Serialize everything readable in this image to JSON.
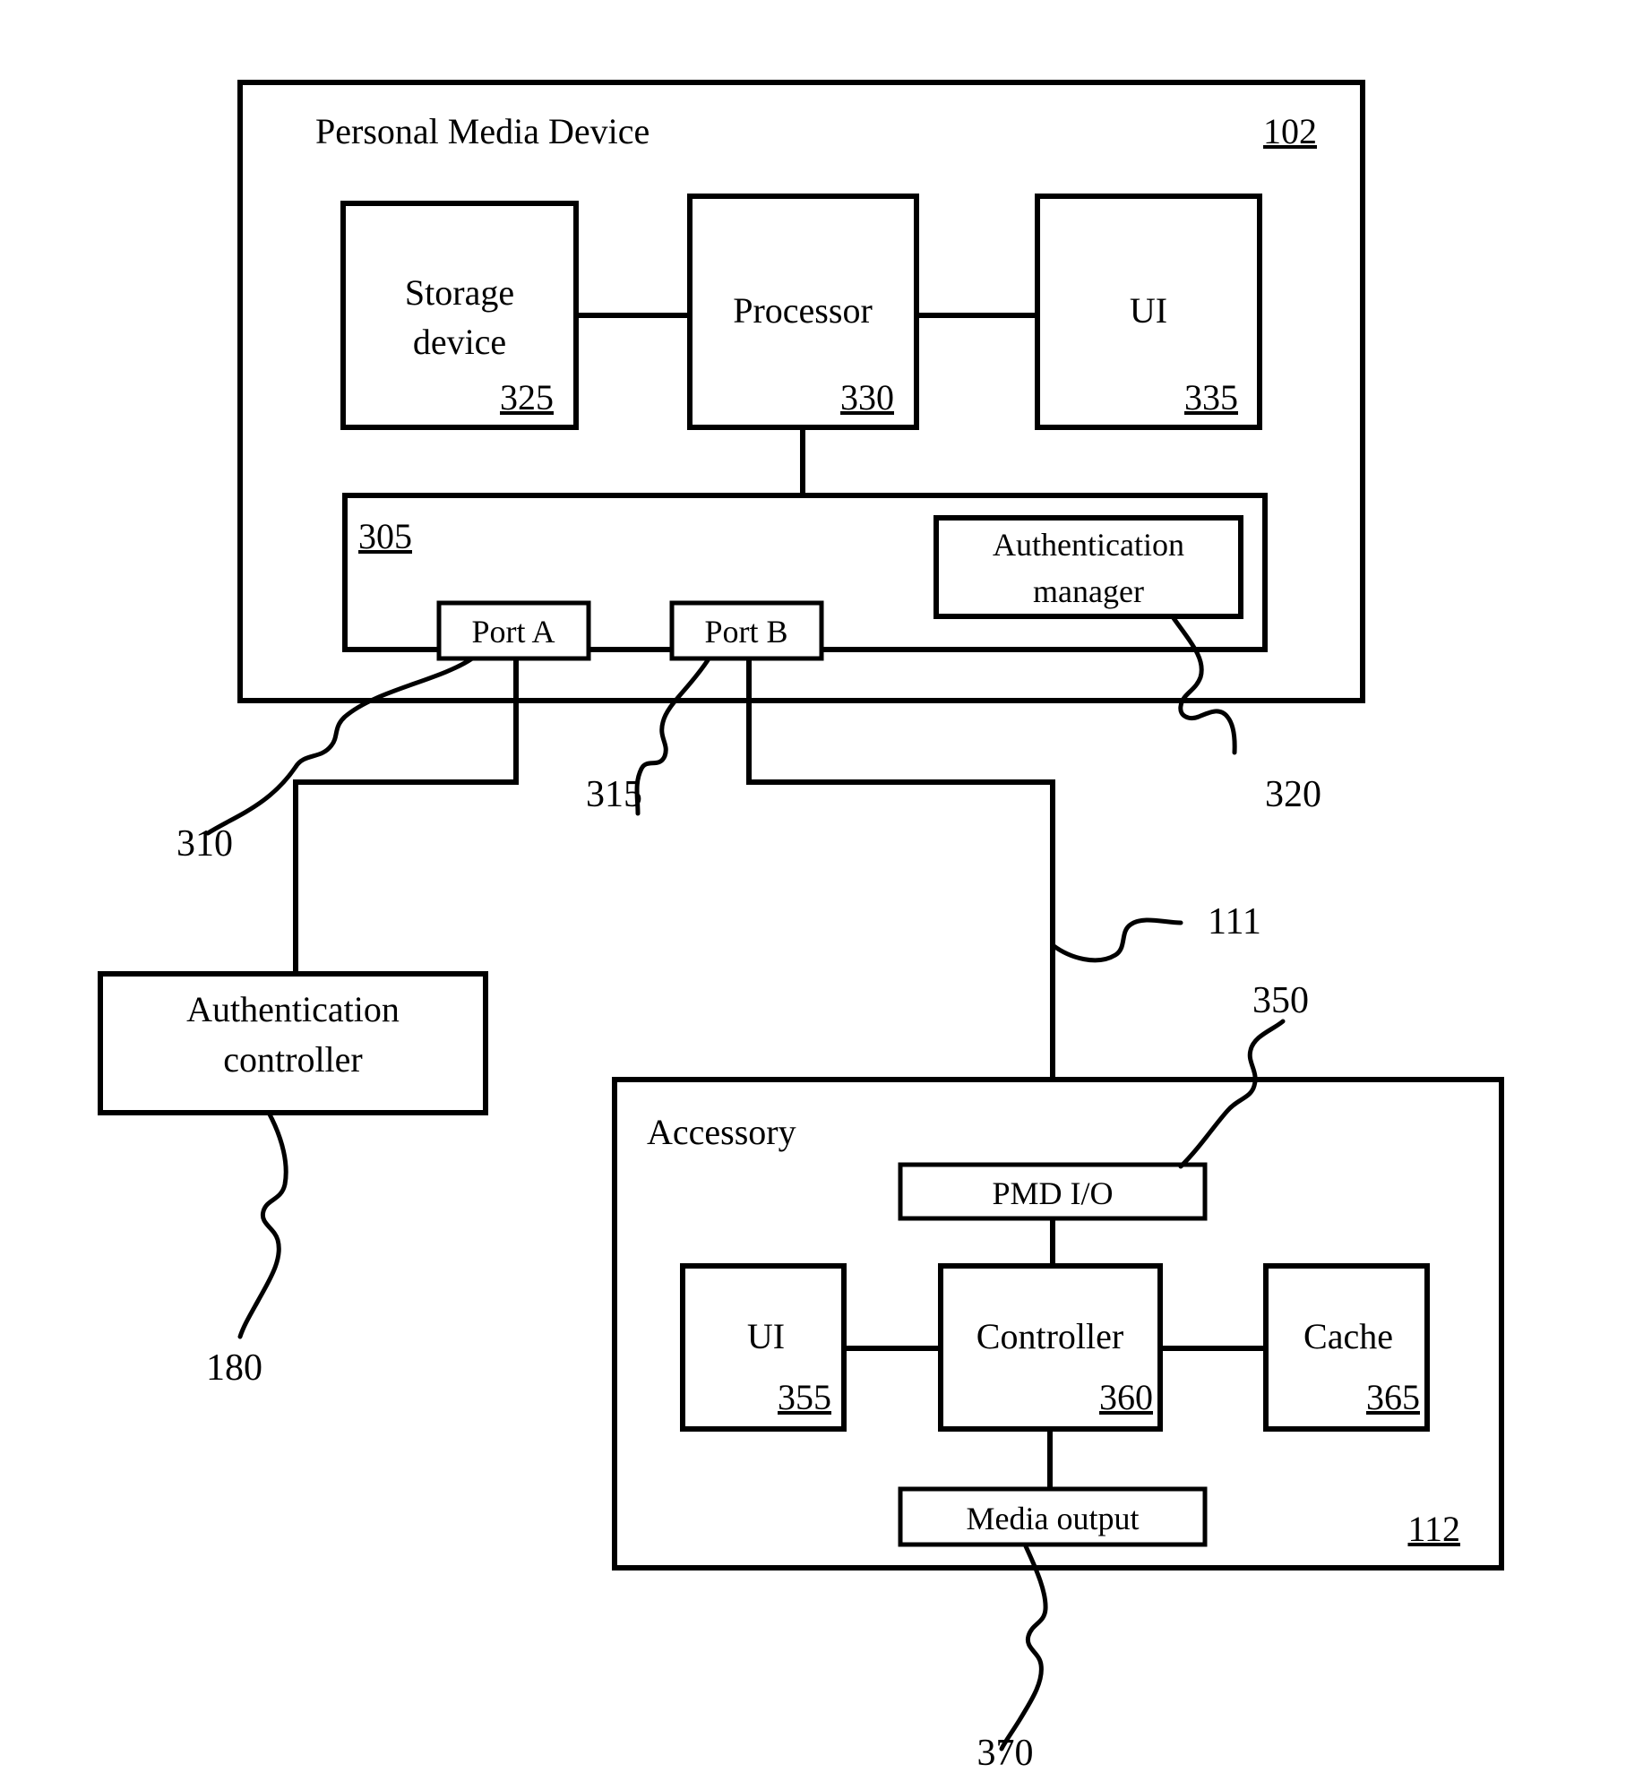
{
  "figure": {
    "type": "patent-block-diagram",
    "title": "Personal Media Device and Accessory block diagram"
  },
  "pmd": {
    "label": "Personal Media Device",
    "ref": "102",
    "blocks": {
      "storage": {
        "label_line1": "Storage",
        "label_line2": "device",
        "ref": "325"
      },
      "processor": {
        "label": "Processor",
        "ref": "330"
      },
      "ui": {
        "label": "UI",
        "ref": "335"
      }
    },
    "interface": {
      "ref": "305",
      "port_a": {
        "label": "Port A",
        "ref": "310"
      },
      "port_b": {
        "label": "Port B",
        "ref": "315"
      },
      "auth_manager": {
        "label_line1": "Authentication",
        "label_line2": "manager",
        "ref": "320"
      }
    }
  },
  "auth_controller": {
    "label_line1": "Authentication",
    "label_line2": "controller",
    "ref": "180"
  },
  "accessory": {
    "label": "Accessory",
    "ref": "112",
    "blocks": {
      "pmd_io": {
        "label": "PMD I/O",
        "ref": "350"
      },
      "ui": {
        "label": "UI",
        "ref": "355"
      },
      "controller": {
        "label": "Controller",
        "ref": "360"
      },
      "cache": {
        "label": "Cache",
        "ref": "365"
      },
      "media_output": {
        "label": "Media output",
        "ref": "370"
      }
    }
  },
  "cable": {
    "ref": "111"
  },
  "colors": {
    "ink": "#000000",
    "paper": "#ffffff"
  }
}
